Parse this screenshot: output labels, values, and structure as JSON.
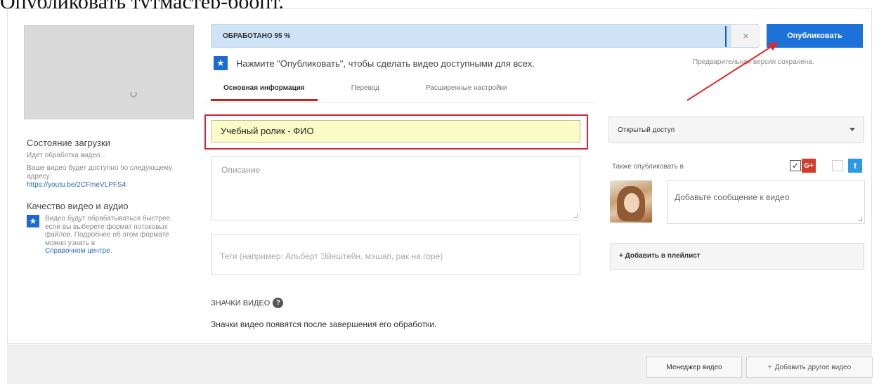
{
  "caption_top": "Опубликовать тутмастер-боопт.",
  "upload": {
    "heading": "Состояние загрузки",
    "status": "Идет обработка видео...",
    "url_intro": "Ваше видео будет доступно по следующему адресу:",
    "url": "https://youtu.be/2CFmeVLPFS4"
  },
  "quality": {
    "heading": "Качество видео и аудио",
    "text": "Видео будут обрабатываться быстрее, если вы выберете формат потоковых файлов. Подробнее об этом формате можно узнать в",
    "link": "Справочном центре."
  },
  "progress": {
    "label": "ОБРАБОТАНО 95 %",
    "value": 95,
    "close_label": "×",
    "publish_label": "Опубликовать"
  },
  "hint": {
    "text": "Нажмите \"Опубликовать\", чтобы сделать видео доступными для всех.",
    "draft_saved": "Предварительная версия сохранена."
  },
  "tabs": [
    {
      "label": "Основная информация",
      "active": true
    },
    {
      "label": "Перевод",
      "active": false
    },
    {
      "label": "Расширенные настройки",
      "active": false
    }
  ],
  "form": {
    "title_value": "Учебный ролик - ФИО",
    "description_placeholder": "Описание",
    "tags_placeholder": "Теги (например: Альберт Эйнштейн, мэшап, рак на горе)"
  },
  "thumbnails": {
    "heading": "ЗНАЧКИ ВИДЕО",
    "help_icon": "?",
    "note": "Значки видео появятся после завершения его обработки."
  },
  "sidebar": {
    "privacy_value": "Открытый доступ",
    "also_publish": "Также опубликовать в",
    "gplus_label": "G+",
    "twitter_label": "t",
    "message_placeholder": "Добавьте сообщение к видео",
    "playlist_label": "+ Добавить в плейлист"
  },
  "footer": {
    "manager_label": "Менеджер видео",
    "add_video_label": "Добавить другое видео",
    "add_plus": "+"
  },
  "colors": {
    "publish_blue": "#1c72d8",
    "progress_bg": "#cfe3f7",
    "title_bg": "#fbfbc7",
    "highlight_red": "#d9232e"
  },
  "icons": {
    "star": "★",
    "check": "✓",
    "spinner": "spinner-icon"
  }
}
